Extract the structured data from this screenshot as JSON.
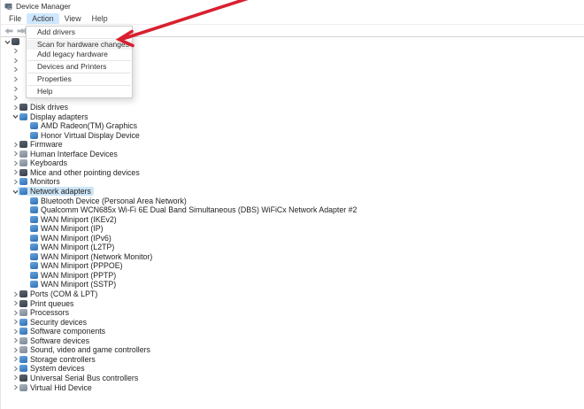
{
  "window": {
    "title": "Device Manager"
  },
  "menubar": {
    "items": [
      {
        "label": "File",
        "active": false
      },
      {
        "label": "Action",
        "active": true
      },
      {
        "label": "View",
        "active": false
      },
      {
        "label": "Help",
        "active": false
      }
    ]
  },
  "toolbar": {
    "buttons": [
      {
        "name": "back",
        "icon": "back-arrow-icon"
      },
      {
        "name": "forward",
        "icon": "forward-arrow-icon"
      }
    ]
  },
  "action_menu": {
    "items": [
      {
        "type": "item",
        "label": "Add drivers",
        "hover": false
      },
      {
        "type": "separator"
      },
      {
        "type": "item",
        "label": "Scan for hardware changes",
        "hover": true
      },
      {
        "type": "item",
        "label": "Add legacy hardware",
        "hover": false
      },
      {
        "type": "separator"
      },
      {
        "type": "item",
        "label": "Devices and Printers",
        "hover": false
      },
      {
        "type": "separator"
      },
      {
        "type": "item",
        "label": "Properties",
        "hover": false
      },
      {
        "type": "separator"
      },
      {
        "type": "item",
        "label": "Help",
        "hover": false
      }
    ]
  },
  "tree": {
    "rows": [
      {
        "depth": 0,
        "state": "expanded",
        "icon": "computer",
        "color": "dark",
        "label": null,
        "occluded": true
      },
      {
        "depth": 1,
        "state": "collapsed",
        "icon": null,
        "color": null,
        "label": null,
        "occluded": true
      },
      {
        "depth": 1,
        "state": "collapsed",
        "icon": null,
        "color": null,
        "label": null,
        "occluded": true
      },
      {
        "depth": 1,
        "state": "collapsed",
        "icon": null,
        "color": null,
        "label": null,
        "occluded": true
      },
      {
        "depth": 1,
        "state": "collapsed",
        "icon": null,
        "color": null,
        "label": null,
        "occluded": true
      },
      {
        "depth": 1,
        "state": "collapsed",
        "icon": null,
        "color": null,
        "label": null,
        "occluded": true
      },
      {
        "depth": 1,
        "state": "collapsed",
        "icon": null,
        "color": null,
        "label": null,
        "occluded": true
      },
      {
        "depth": 1,
        "state": "collapsed",
        "icon": "disk-drive",
        "color": "dark",
        "label": "Disk drives"
      },
      {
        "depth": 1,
        "state": "expanded",
        "icon": "display-adapter",
        "color": "blue",
        "label": "Display adapters"
      },
      {
        "depth": 2,
        "state": null,
        "icon": "display-adapter",
        "color": "blue",
        "label": "AMD Radeon(TM) Graphics"
      },
      {
        "depth": 2,
        "state": null,
        "icon": "virtual-display",
        "color": "blue",
        "label": "Honor Virtual Display Device"
      },
      {
        "depth": 1,
        "state": "collapsed",
        "icon": "firmware",
        "color": "dark",
        "label": "Firmware"
      },
      {
        "depth": 1,
        "state": "collapsed",
        "icon": "hid-device",
        "color": "grey",
        "label": "Human Interface Devices"
      },
      {
        "depth": 1,
        "state": "collapsed",
        "icon": "keyboard",
        "color": "grey",
        "label": "Keyboards"
      },
      {
        "depth": 1,
        "state": "collapsed",
        "icon": "mouse",
        "color": "dark",
        "label": "Mice and other pointing devices"
      },
      {
        "depth": 1,
        "state": "collapsed",
        "icon": "monitor",
        "color": "blue",
        "label": "Monitors"
      },
      {
        "depth": 1,
        "state": "expanded",
        "icon": "network-adapter",
        "color": "blue",
        "label": "Network adapters",
        "selected": true
      },
      {
        "depth": 2,
        "state": null,
        "icon": "network-adapter",
        "color": "blue",
        "label": "Bluetooth Device (Personal Area Network)"
      },
      {
        "depth": 2,
        "state": null,
        "icon": "network-adapter",
        "color": "blue",
        "label": "Qualcomm WCN685x Wi-Fi 6E Dual Band Simultaneous (DBS) WiFiCx Network Adapter #2"
      },
      {
        "depth": 2,
        "state": null,
        "icon": "network-adapter",
        "color": "blue",
        "label": "WAN Miniport (IKEv2)"
      },
      {
        "depth": 2,
        "state": null,
        "icon": "network-adapter",
        "color": "blue",
        "label": "WAN Miniport (IP)"
      },
      {
        "depth": 2,
        "state": null,
        "icon": "network-adapter",
        "color": "blue",
        "label": "WAN Miniport (IPv6)"
      },
      {
        "depth": 2,
        "state": null,
        "icon": "network-adapter",
        "color": "blue",
        "label": "WAN Miniport (L2TP)"
      },
      {
        "depth": 2,
        "state": null,
        "icon": "network-adapter",
        "color": "blue",
        "label": "WAN Miniport (Network Monitor)"
      },
      {
        "depth": 2,
        "state": null,
        "icon": "network-adapter",
        "color": "blue",
        "label": "WAN Miniport (PPPOE)"
      },
      {
        "depth": 2,
        "state": null,
        "icon": "network-adapter",
        "color": "blue",
        "label": "WAN Miniport (PPTP)"
      },
      {
        "depth": 2,
        "state": null,
        "icon": "network-adapter",
        "color": "blue",
        "label": "WAN Miniport (SSTP)"
      },
      {
        "depth": 1,
        "state": "collapsed",
        "icon": "serial-port",
        "color": "dark",
        "label": "Ports (COM & LPT)"
      },
      {
        "depth": 1,
        "state": "collapsed",
        "icon": "printer",
        "color": "dark",
        "label": "Print queues"
      },
      {
        "depth": 1,
        "state": "collapsed",
        "icon": "processor",
        "color": "grey",
        "label": "Processors"
      },
      {
        "depth": 1,
        "state": "collapsed",
        "icon": "security-device",
        "color": "blue",
        "label": "Security devices"
      },
      {
        "depth": 1,
        "state": "collapsed",
        "icon": "software-component",
        "color": "blue",
        "label": "Software components"
      },
      {
        "depth": 1,
        "state": "collapsed",
        "icon": "software-device",
        "color": "grey",
        "label": "Software devices"
      },
      {
        "depth": 1,
        "state": "collapsed",
        "icon": "sound-controller",
        "color": "grey",
        "label": "Sound, video and game controllers"
      },
      {
        "depth": 1,
        "state": "collapsed",
        "icon": "storage-controller",
        "color": "blue",
        "label": "Storage controllers"
      },
      {
        "depth": 1,
        "state": "collapsed",
        "icon": "system-device",
        "color": "blue",
        "label": "System devices"
      },
      {
        "depth": 1,
        "state": "collapsed",
        "icon": "usb-controller",
        "color": "dark",
        "label": "Universal Serial Bus controllers"
      },
      {
        "depth": 1,
        "state": "collapsed",
        "icon": "virtual-hid",
        "color": "grey",
        "label": "Virtual Hid Device"
      }
    ]
  },
  "annotation": {
    "arrow_color": "#d9202f",
    "points_to": "Scan for hardware changes"
  },
  "colors": {
    "selection_highlight": "#cde6f7",
    "menubar_highlight": "#cfe8ff",
    "menu_hover": "#f3f3f3",
    "toolbar_border": "#d6d6d6"
  }
}
